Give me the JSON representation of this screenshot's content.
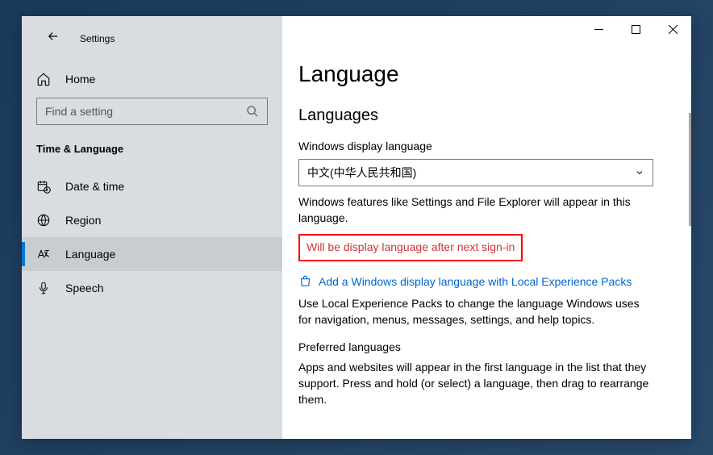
{
  "titlebar": {
    "app_name": "Settings"
  },
  "sidebar": {
    "home_label": "Home",
    "search_placeholder": "Find a setting",
    "category": "Time & Language",
    "items": [
      {
        "label": "Date & time",
        "icon": "calendar-clock-icon",
        "active": false
      },
      {
        "label": "Region",
        "icon": "globe-icon",
        "active": false
      },
      {
        "label": "Language",
        "icon": "language-icon",
        "active": true
      },
      {
        "label": "Speech",
        "icon": "microphone-icon",
        "active": false
      }
    ]
  },
  "content": {
    "page_title": "Language",
    "section_languages": "Languages",
    "display_lang_label": "Windows display language",
    "display_lang_value": "中文(中华人民共和国)",
    "display_lang_desc": "Windows features like Settings and File Explorer will appear in this language.",
    "pending_note": "Will be display language after next sign-in",
    "add_lang_link": "Add a Windows display language with Local Experience Packs",
    "lep_desc": "Use Local Experience Packs to change the language Windows uses for navigation, menus, messages, settings, and help topics.",
    "preferred_header": "Preferred languages",
    "preferred_desc": "Apps and websites will appear in the first language in the list that they support. Press and hold (or select) a language, then drag to rearrange them."
  }
}
